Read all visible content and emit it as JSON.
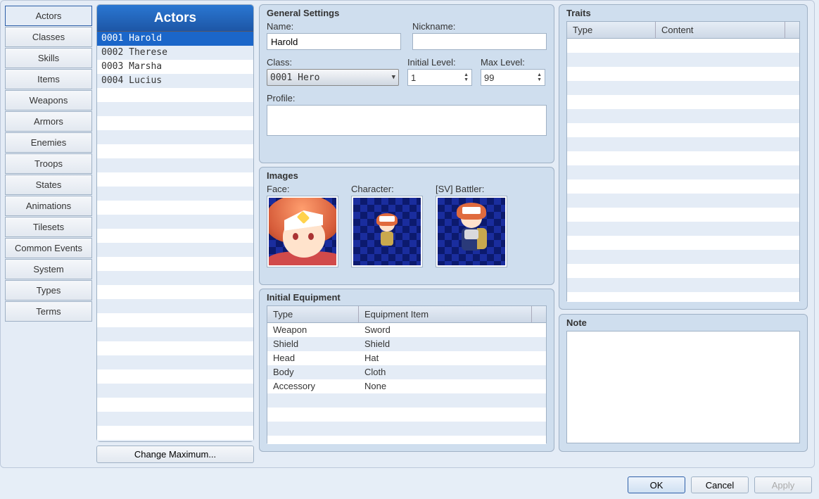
{
  "categories": [
    "Actors",
    "Classes",
    "Skills",
    "Items",
    "Weapons",
    "Armors",
    "Enemies",
    "Troops",
    "States",
    "Animations",
    "Tilesets",
    "Common Events",
    "System",
    "Types",
    "Terms"
  ],
  "active_category_index": 0,
  "list": {
    "title": "Actors",
    "items": [
      "0001 Harold",
      "0002 Therese",
      "0003 Marsha",
      "0004 Lucius"
    ],
    "selected_index": 0
  },
  "change_max_label": "Change Maximum...",
  "general": {
    "title": "General Settings",
    "name_label": "Name:",
    "name_value": "Harold",
    "nickname_label": "Nickname:",
    "nickname_value": "",
    "class_label": "Class:",
    "class_value": "0001 Hero",
    "ilvl_label": "Initial Level:",
    "ilvl_value": "1",
    "mlvl_label": "Max Level:",
    "mlvl_value": "99",
    "profile_label": "Profile:",
    "profile_value": ""
  },
  "images": {
    "title": "Images",
    "face_label": "Face:",
    "char_label": "Character:",
    "sv_label": "[SV] Battler:"
  },
  "equip": {
    "title": "Initial Equipment",
    "col_type": "Type",
    "col_item": "Equipment Item",
    "rows": [
      {
        "type": "Weapon",
        "item": "Sword"
      },
      {
        "type": "Shield",
        "item": "Shield"
      },
      {
        "type": "Head",
        "item": "Hat"
      },
      {
        "type": "Body",
        "item": "Cloth"
      },
      {
        "type": "Accessory",
        "item": "None"
      }
    ]
  },
  "traits": {
    "title": "Traits",
    "col_type": "Type",
    "col_content": "Content"
  },
  "note": {
    "title": "Note",
    "value": ""
  },
  "buttons": {
    "ok": "OK",
    "cancel": "Cancel",
    "apply": "Apply"
  }
}
